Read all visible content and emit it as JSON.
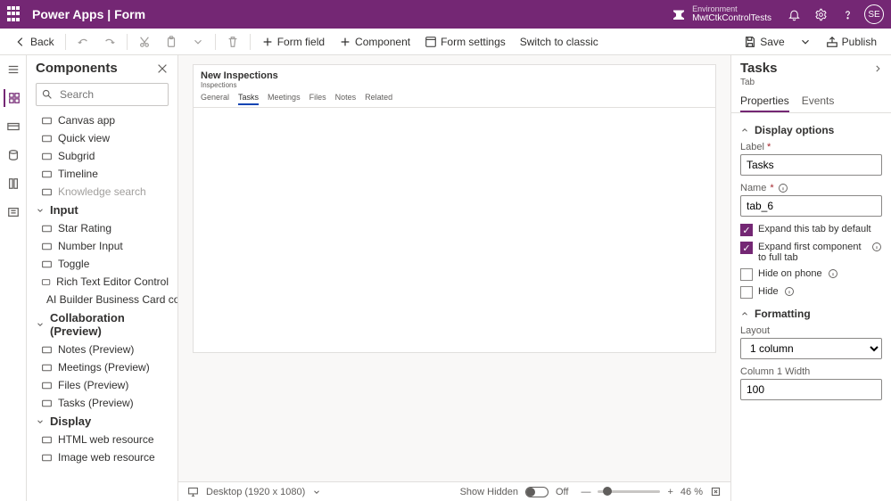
{
  "header": {
    "app_title": "Power Apps  |  Form",
    "env_label": "Environment",
    "env_name": "MwtCtkControlTests",
    "avatar_initials": "SE"
  },
  "cmdbar": {
    "back": "Back",
    "form_field": "Form field",
    "component": "Component",
    "form_settings": "Form settings",
    "switch": "Switch to classic",
    "save": "Save",
    "publish": "Publish"
  },
  "components": {
    "title": "Components",
    "search_placeholder": "Search",
    "items_top": [
      {
        "label": "Canvas app"
      },
      {
        "label": "Quick view"
      },
      {
        "label": "Subgrid"
      },
      {
        "label": "Timeline"
      },
      {
        "label": "Knowledge search",
        "disabled": true
      }
    ],
    "cat_input": "Input",
    "items_input": [
      {
        "label": "Star Rating"
      },
      {
        "label": "Number Input"
      },
      {
        "label": "Toggle"
      },
      {
        "label": "Rich Text Editor Control"
      },
      {
        "label": "AI Builder Business Card co..."
      }
    ],
    "cat_collab": "Collaboration (Preview)",
    "items_collab": [
      {
        "label": "Notes (Preview)"
      },
      {
        "label": "Meetings (Preview)"
      },
      {
        "label": "Files (Preview)"
      },
      {
        "label": "Tasks (Preview)"
      }
    ],
    "cat_display": "Display",
    "items_display": [
      {
        "label": "HTML web resource"
      },
      {
        "label": "Image web resource"
      }
    ]
  },
  "form": {
    "title": "New Inspections",
    "subtitle": "Inspections",
    "tabs": [
      "General",
      "Tasks",
      "Meetings",
      "Files",
      "Notes",
      "Related"
    ],
    "active_tab_index": 1
  },
  "statusbar": {
    "viewport": "Desktop (1920 x 1080)",
    "show_hidden": "Show Hidden",
    "show_hidden_state": "Off",
    "zoom": "46 %"
  },
  "rightpanel": {
    "title": "Tasks",
    "subtitle": "Tab",
    "tabs": {
      "properties": "Properties",
      "events": "Events"
    },
    "section_display": "Display options",
    "label_label": "Label",
    "label_value": "Tasks",
    "name_label": "Name",
    "name_value": "tab_6",
    "chk_expand_default": "Expand this tab by default",
    "chk_expand_first": "Expand first component to full tab",
    "chk_hide_phone": "Hide on phone",
    "chk_hide": "Hide",
    "section_formatting": "Formatting",
    "layout_label": "Layout",
    "layout_value": "1 column",
    "col_width_label": "Column 1 Width",
    "col_width_value": "100"
  }
}
